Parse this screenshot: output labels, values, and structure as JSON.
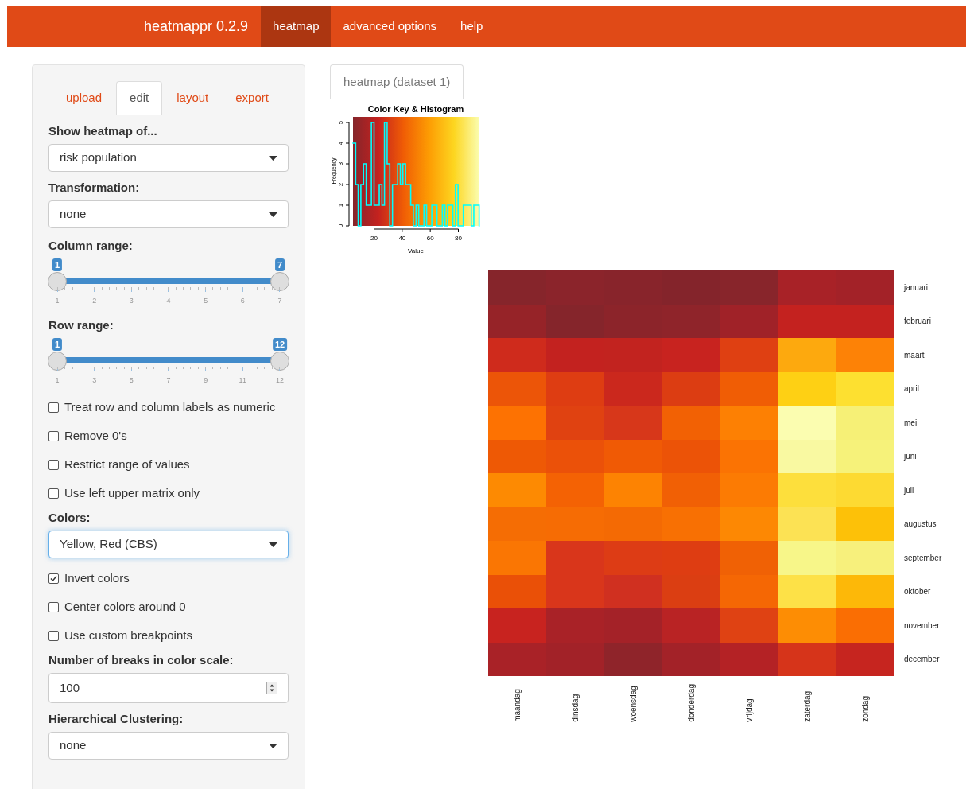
{
  "navbar": {
    "brand": "heatmappr 0.2.9",
    "items": [
      {
        "label": "heatmap",
        "selected": true
      },
      {
        "label": "advanced options",
        "selected": false
      },
      {
        "label": "help",
        "selected": false
      }
    ]
  },
  "sidebar": {
    "tabs": [
      {
        "label": "upload",
        "selected": false
      },
      {
        "label": "edit",
        "selected": true
      },
      {
        "label": "layout",
        "selected": false
      },
      {
        "label": "export",
        "selected": false
      }
    ],
    "controls": [
      {
        "kind": "select",
        "label": "Show heatmap of...",
        "value": "risk population",
        "focused": false
      },
      {
        "kind": "select",
        "label": "Transformation:",
        "value": "none",
        "focused": false
      },
      {
        "kind": "slider",
        "label": "Column range:",
        "low": "1",
        "high": "7",
        "ticks": [
          "1",
          "2",
          "3",
          "4",
          "5",
          "6",
          "7"
        ]
      },
      {
        "kind": "slider",
        "label": "Row range:",
        "low": "1",
        "high": "12",
        "ticks": [
          "1",
          "3",
          "5",
          "7",
          "9",
          "11",
          "12"
        ]
      },
      {
        "kind": "checkbox",
        "label": "Treat row and column labels as numeric",
        "checked": false
      },
      {
        "kind": "checkbox",
        "label": "Remove 0's",
        "checked": false
      },
      {
        "kind": "checkbox",
        "label": "Restrict range of values",
        "checked": false
      },
      {
        "kind": "checkbox",
        "label": "Use left upper matrix only",
        "checked": false
      },
      {
        "kind": "select",
        "label": "Colors:",
        "value": "Yellow, Red (CBS)",
        "focused": true
      },
      {
        "kind": "checkbox",
        "label": "Invert colors",
        "checked": true
      },
      {
        "kind": "checkbox",
        "label": "Center colors around 0",
        "checked": false
      },
      {
        "kind": "checkbox",
        "label": "Use custom breakpoints",
        "checked": false
      },
      {
        "kind": "number",
        "label": "Number of breaks in color scale:",
        "value": "100"
      },
      {
        "kind": "select",
        "label": "Hierarchical Clustering:",
        "value": "none",
        "focused": false
      }
    ]
  },
  "main": {
    "tabs": [
      {
        "label": "heatmap (dataset 1)",
        "selected": true
      }
    ],
    "color_key": {
      "chart_data": {
        "type": "line",
        "title": "Color Key & Histogram",
        "xlabel": "Value",
        "ylabel": "Frequency",
        "xlim": [
          5,
          95
        ],
        "ylim": [
          0,
          5.27
        ],
        "xticks": [
          20,
          40,
          60,
          80
        ],
        "yticks": [
          0,
          1,
          2,
          3,
          4,
          5
        ],
        "x": [
          5.0,
          6.9,
          6.9,
          8.7,
          8.7,
          10.6,
          10.6,
          12.5,
          12.5,
          14.4,
          14.4,
          18.1,
          18.1,
          20.0,
          20.0,
          23.7,
          23.7,
          25.6,
          25.6,
          27.4,
          27.4,
          29.3,
          29.3,
          31.2,
          31.2,
          33.1,
          33.1,
          36.8,
          36.8,
          38.7,
          38.7,
          40.5,
          40.5,
          42.4,
          42.4,
          46.1,
          46.1,
          48.0,
          48.0,
          49.9,
          49.9,
          51.8,
          51.8,
          55.5,
          55.5,
          57.4,
          57.4,
          61.1,
          61.1,
          64.8,
          64.8,
          68.6,
          68.6,
          70.5,
          70.5,
          72.3,
          72.3,
          76.1,
          76.1,
          77.9,
          77.9,
          79.8,
          79.8,
          83.5,
          83.5,
          89.2,
          89.2,
          91.0,
          91.0,
          94.8,
          94.8
        ],
        "series": [
          {
            "color": "#00ffff",
            "values": [
              4,
              4,
              2,
              2,
              0,
              0,
              2,
              2,
              3,
              3,
              1,
              1,
              5,
              5,
              1,
              1,
              2,
              2,
              1,
              1,
              5,
              5,
              3,
              3,
              0,
              0,
              2,
              2,
              3,
              3,
              2,
              2,
              3,
              3,
              2,
              2,
              1,
              1,
              0,
              0,
              1,
              1,
              0,
              0,
              1,
              1,
              0,
              0,
              1,
              1,
              0,
              0,
              1,
              1,
              0,
              0,
              1,
              1,
              0,
              0,
              2,
              2,
              0,
              0,
              1,
              1,
              0,
              0,
              1,
              1,
              0
            ]
          }
        ]
      }
    },
    "heatmap": {
      "columns": [
        "maandag",
        "dinsdag",
        "woensdag",
        "donderdag",
        "vrijdag",
        "zaterdag",
        "zondag"
      ],
      "rows": [
        {
          "label": "januari",
          "cells": [
            {
              "color": "#86252b"
            },
            {
              "color": "#8b242b"
            },
            {
              "color": "#88242b"
            },
            {
              "color": "#84242b"
            },
            {
              "color": "#88252b"
            },
            {
              "color": "#a82227"
            },
            {
              "color": "#a32228"
            }
          ]
        },
        {
          "label": "februari",
          "cells": [
            {
              "color": "#962328"
            },
            {
              "color": "#85252b"
            },
            {
              "color": "#8c242a"
            },
            {
              "color": "#8f242a"
            },
            {
              "color": "#a02228"
            },
            {
              "color": "#c4221f"
            },
            {
              "color": "#c4221f"
            }
          ]
        },
        {
          "label": "maart",
          "cells": [
            {
              "color": "#cf2b1c"
            },
            {
              "color": "#c3221f"
            },
            {
              "color": "#c2231f"
            },
            {
              "color": "#c8231f"
            },
            {
              "color": "#df4012"
            },
            {
              "color": "#fda90e"
            },
            {
              "color": "#fd8206"
            }
          ]
        },
        {
          "label": "april",
          "cells": [
            {
              "color": "#ec5508"
            },
            {
              "color": "#de3d12"
            },
            {
              "color": "#cb281d"
            },
            {
              "color": "#dc3d12"
            },
            {
              "color": "#f05d05"
            },
            {
              "color": "#fed014"
            },
            {
              "color": "#fde030"
            }
          ]
        },
        {
          "label": "mei",
          "cells": [
            {
              "color": "#fd7202"
            },
            {
              "color": "#e04211"
            },
            {
              "color": "#d7371a"
            },
            {
              "color": "#f26104"
            },
            {
              "color": "#fd8003"
            },
            {
              "color": "#fbfdb0"
            },
            {
              "color": "#f6f076"
            }
          ]
        },
        {
          "label": "juni",
          "cells": [
            {
              "color": "#ee5905"
            },
            {
              "color": "#eb5109"
            },
            {
              "color": "#f05a05"
            },
            {
              "color": "#ec5307"
            },
            {
              "color": "#fb7303"
            },
            {
              "color": "#f9f9a1"
            },
            {
              "color": "#f6f27a"
            }
          ]
        },
        {
          "label": "juli",
          "cells": [
            {
              "color": "#fd8a02"
            },
            {
              "color": "#f46204"
            },
            {
              "color": "#fd8302"
            },
            {
              "color": "#f16005"
            },
            {
              "color": "#fc7b03"
            },
            {
              "color": "#fddf3c"
            },
            {
              "color": "#fdda32"
            }
          ]
        },
        {
          "label": "augustus",
          "cells": [
            {
              "color": "#f56d04"
            },
            {
              "color": "#f66c04"
            },
            {
              "color": "#f46a04"
            },
            {
              "color": "#f87003"
            },
            {
              "color": "#fd8803"
            },
            {
              "color": "#fce254"
            },
            {
              "color": "#fdc108"
            }
          ]
        },
        {
          "label": "september",
          "cells": [
            {
              "color": "#fa7603"
            },
            {
              "color": "#d9361b"
            },
            {
              "color": "#dd3c15"
            },
            {
              "color": "#de3d12"
            },
            {
              "color": "#f06105"
            },
            {
              "color": "#f7f689"
            },
            {
              "color": "#f7f07c"
            }
          ]
        },
        {
          "label": "oktober",
          "cells": [
            {
              "color": "#ea5007"
            },
            {
              "color": "#d9361b"
            },
            {
              "color": "#d03020"
            },
            {
              "color": "#db3e12"
            },
            {
              "color": "#f56704"
            },
            {
              "color": "#fde147"
            },
            {
              "color": "#fdb808"
            }
          ]
        },
        {
          "label": "november",
          "cells": [
            {
              "color": "#c8231f"
            },
            {
              "color": "#a92227"
            },
            {
              "color": "#a42228"
            },
            {
              "color": "#b92324"
            },
            {
              "color": "#df4213"
            },
            {
              "color": "#fd8d04"
            },
            {
              "color": "#fa6e03"
            }
          ]
        },
        {
          "label": "december",
          "cells": [
            {
              "color": "#a92227"
            },
            {
              "color": "#a22228"
            },
            {
              "color": "#8f242a"
            },
            {
              "color": "#a32228"
            },
            {
              "color": "#b42225"
            },
            {
              "color": "#d6341a"
            },
            {
              "color": "#c6251f"
            }
          ]
        }
      ]
    }
  }
}
